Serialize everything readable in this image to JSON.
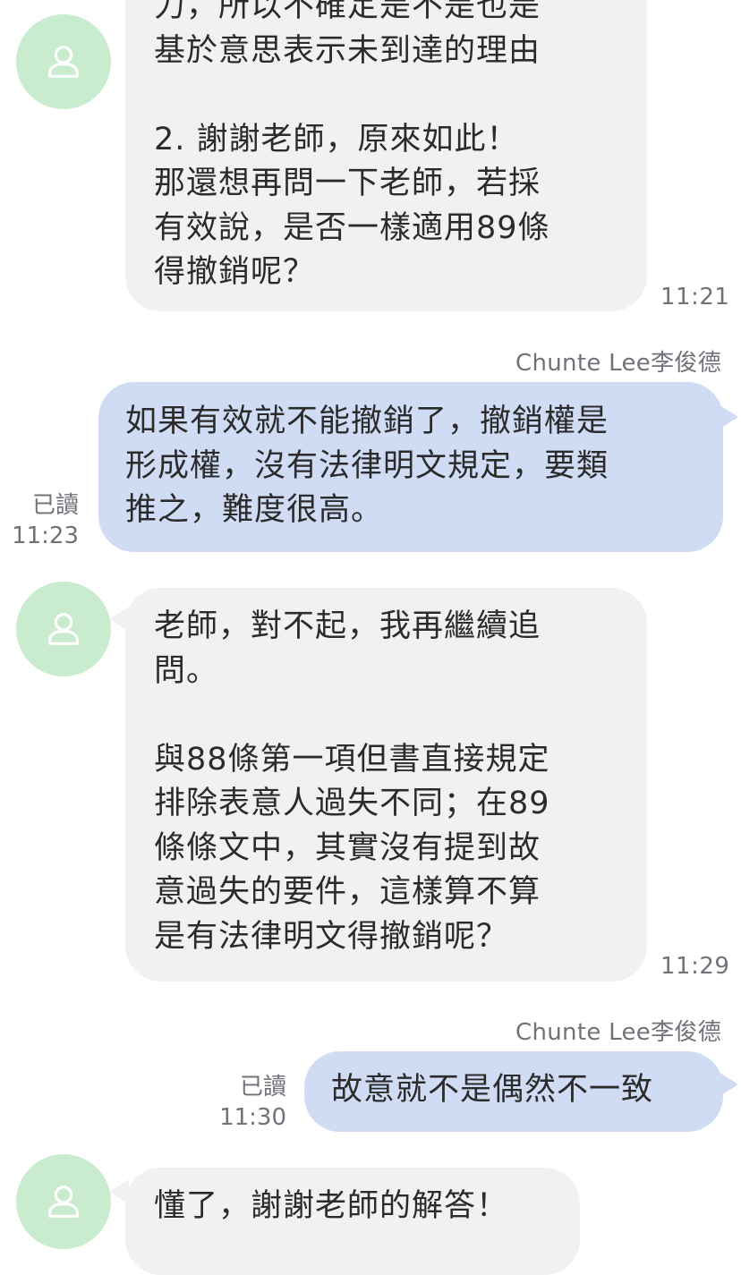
{
  "messages": [
    {
      "direction": "incoming",
      "text": "力，所以不確定是不是也是\n基於意思表示未到達的理由\n\n2. 謝謝老師，原來如此！\n那還想再問一下老師，若採\n有效說，是否一樣適用89條\n得撤銷呢？",
      "time": "11:21",
      "avatar_icon": "person-outline-icon"
    },
    {
      "direction": "outgoing",
      "sender": "Chunte  Lee李俊德",
      "text": "如果有效就不能撤銷了，撤銷權是\n形成權，沒有法律明文規定，要類\n推之，難度很高。",
      "read_label": "已讀",
      "time": "11:23"
    },
    {
      "direction": "incoming",
      "text": "老師，對不起，我再繼續追\n問。\n\n與88條第一項但書直接規定\n排除表意人過失不同；在89\n條條文中，其實沒有提到故\n意過失的要件，這樣算不算\n是有法律明文得撤銷呢？",
      "time": "11:29",
      "avatar_icon": "person-outline-icon"
    },
    {
      "direction": "outgoing",
      "sender": "Chunte  Lee李俊德",
      "text": "故意就不是偶然不一致",
      "read_label": "已讀",
      "time": "11:30"
    },
    {
      "direction": "incoming",
      "text": "懂了，謝謝老師的解答！",
      "time": "",
      "avatar_icon": "person-outline-icon"
    }
  ],
  "colors": {
    "background": "#ffffff",
    "incoming_bubble": "#f0f1f3",
    "outgoing_bubble": "#cfdcf4",
    "avatar_bg": "#c9eccf",
    "avatar_icon": "#ffffff",
    "meta_text": "#6f7379"
  }
}
